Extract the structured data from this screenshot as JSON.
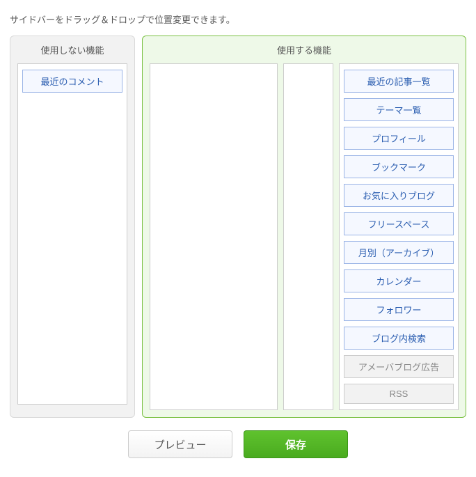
{
  "instruction": "サイドバーをドラッグ＆ドロップで位置変更できます。",
  "panels": {
    "unused_title": "使用しない機能",
    "used_title": "使用する機能"
  },
  "unused_widgets": [
    {
      "label": "最近のコメント",
      "enabled": true
    }
  ],
  "used_widgets": [
    {
      "label": "最近の記事一覧",
      "enabled": true
    },
    {
      "label": "テーマ一覧",
      "enabled": true
    },
    {
      "label": "プロフィール",
      "enabled": true
    },
    {
      "label": "ブックマーク",
      "enabled": true
    },
    {
      "label": "お気に入りブログ",
      "enabled": true
    },
    {
      "label": "フリースペース",
      "enabled": true
    },
    {
      "label": "月別（アーカイブ）",
      "enabled": true
    },
    {
      "label": "カレンダー",
      "enabled": true
    },
    {
      "label": "フォロワー",
      "enabled": true
    },
    {
      "label": "ブログ内検索",
      "enabled": true
    },
    {
      "label": "アメーバブログ広告",
      "enabled": false
    },
    {
      "label": "RSS",
      "enabled": false
    }
  ],
  "actions": {
    "preview": "プレビュー",
    "save": "保存"
  }
}
